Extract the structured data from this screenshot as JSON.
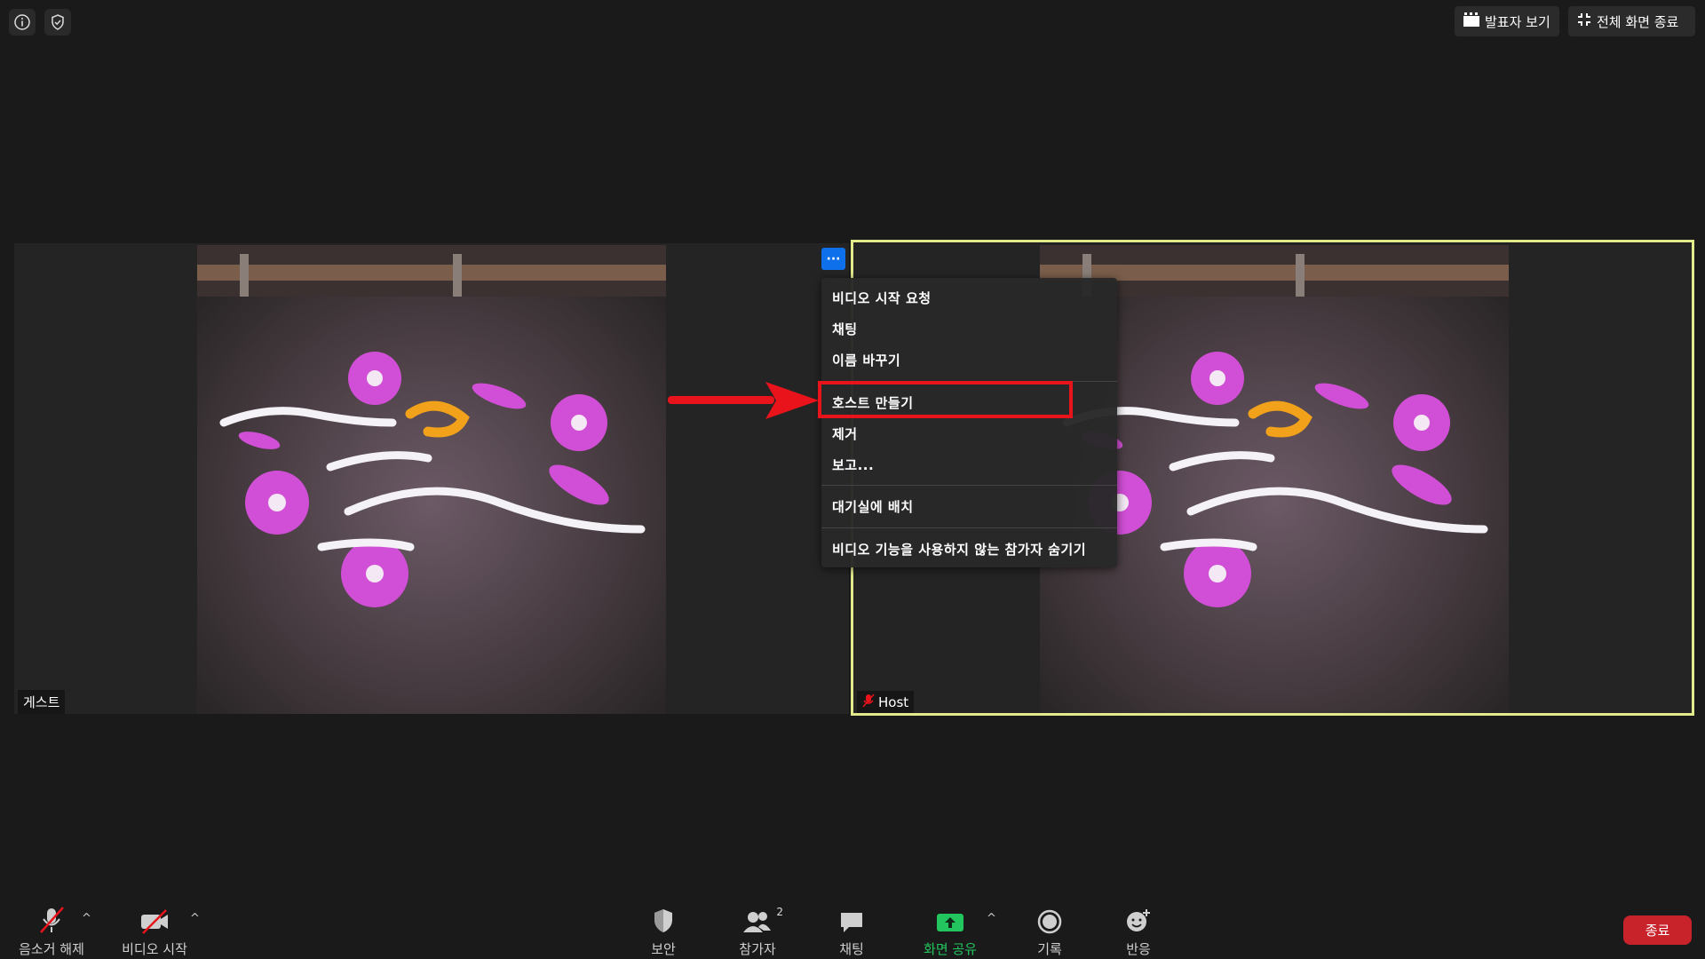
{
  "top_bar": {
    "info_icon": "info-circle",
    "security_icon": "shield-check",
    "speaker_view_label": "발표자 보기",
    "exit_fullscreen_label": "전체 화면 종료"
  },
  "tiles": {
    "guest_name": "게스트",
    "host_name": "Host"
  },
  "more_button_label": "···",
  "context_menu": {
    "items": [
      "비디오 시작 요청",
      "채팅",
      "이름 바꾸기",
      "호스트 만들기",
      "제거",
      "보고...",
      "대기실에 배치",
      "비디오 기능을 사용하지 않는 참가자 숨기기"
    ]
  },
  "toolbar": {
    "unmute_label": "음소거 해제",
    "start_video_label": "비디오 시작",
    "security_label": "보안",
    "participants_label": "참가자",
    "participants_count": "2",
    "chat_label": "채팅",
    "share_screen_label": "화면 공유",
    "record_label": "기록",
    "reactions_label": "반응",
    "end_label": "종료"
  },
  "colors": {
    "background": "#1a1a1a",
    "active_speaker_border": "#e2ea8c",
    "more_button": "#0e71eb",
    "callout": "#e8131b",
    "share_green": "#22c55e",
    "end_button": "#c8232b"
  }
}
